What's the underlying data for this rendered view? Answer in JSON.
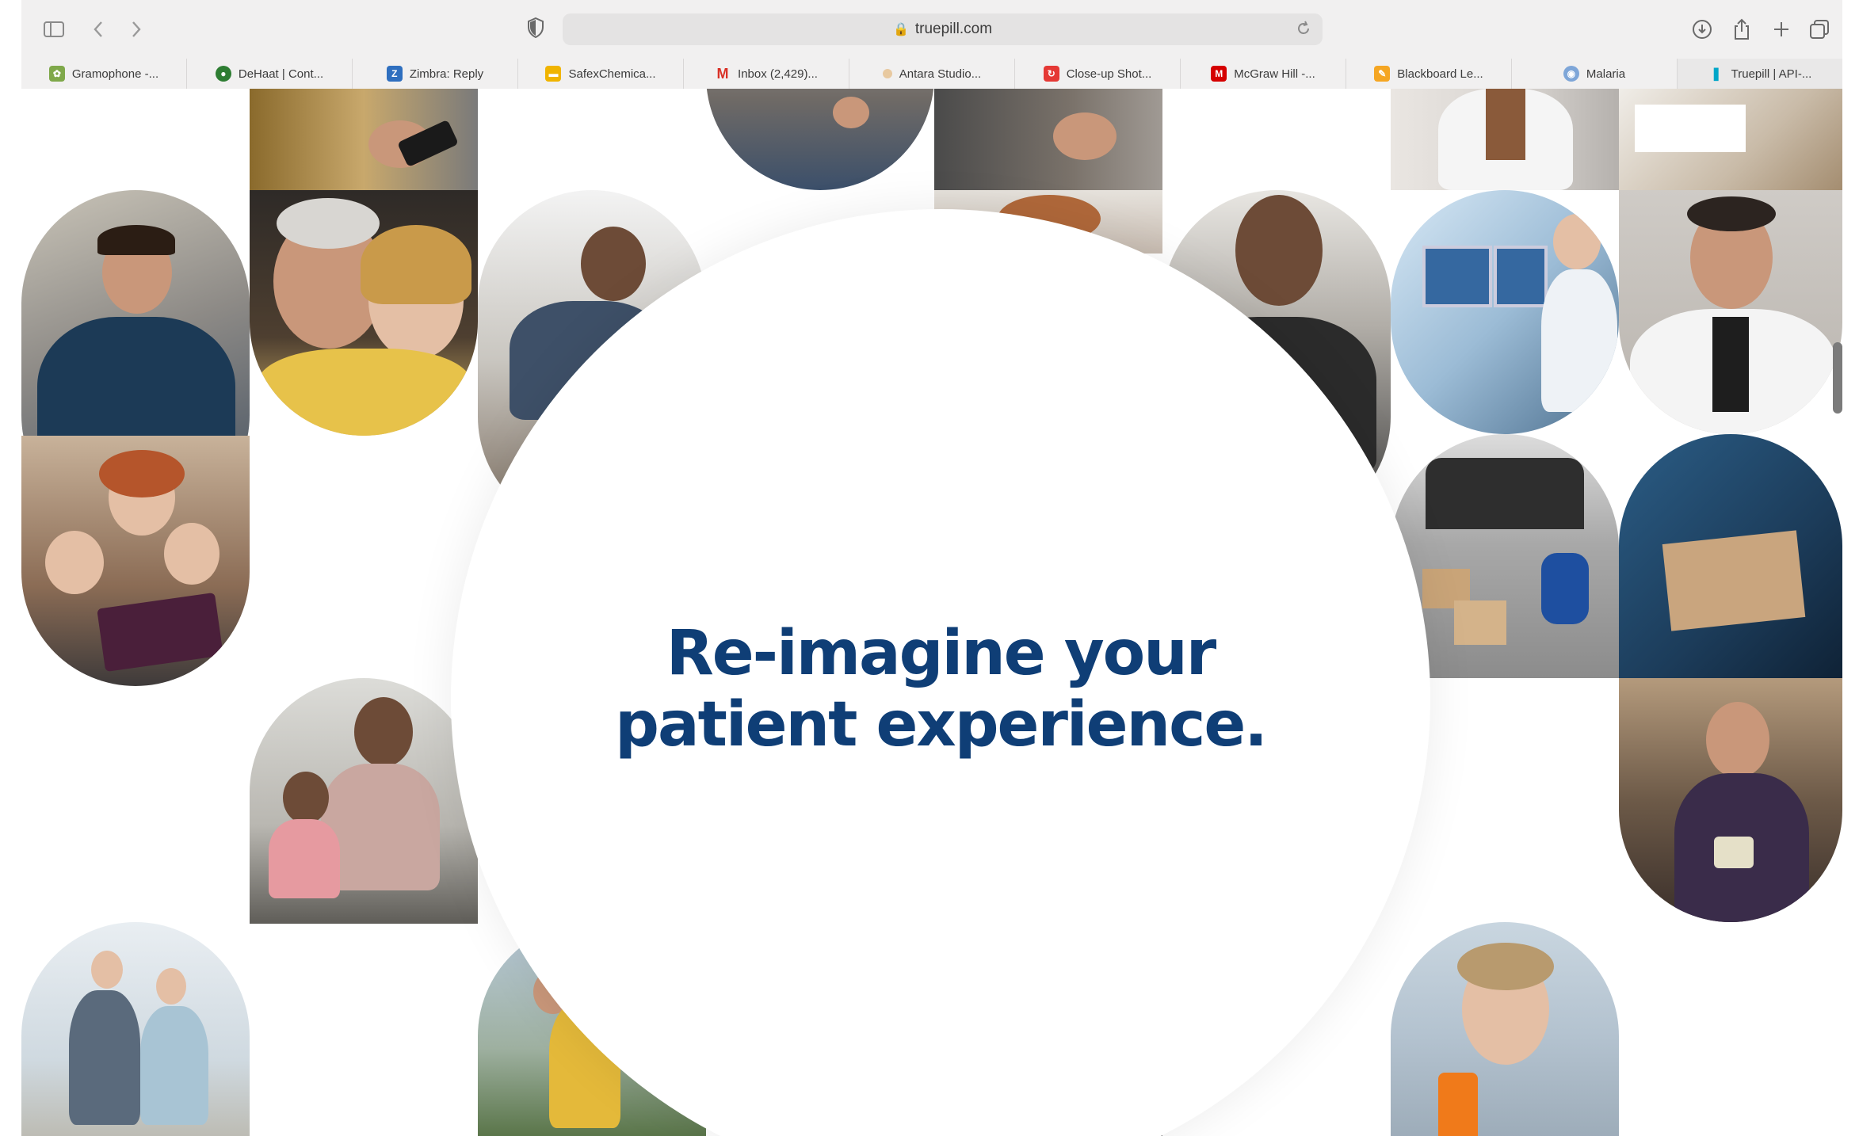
{
  "browser": {
    "url": "truepill.com",
    "bookmarks": [
      {
        "label": "Gramophone -...",
        "icon": "gramophone-favicon",
        "color": "#7fa84a"
      },
      {
        "label": "DeHaat | Cont...",
        "icon": "dehaat-favicon",
        "color": "#2e7d32"
      },
      {
        "label": "Zimbra: Reply",
        "icon": "zimbra-favicon",
        "color": "#2f6fbf"
      },
      {
        "label": "SafexChemica...",
        "icon": "safex-favicon",
        "color": "#f0b400"
      },
      {
        "label": "Inbox (2,429)...",
        "icon": "gmail-favicon",
        "color": "#d93025"
      },
      {
        "label": "Antara Studio...",
        "icon": "antara-favicon",
        "color": "#e8c9a0"
      },
      {
        "label": "Close-up Shot...",
        "icon": "closeup-favicon",
        "color": "#e53935"
      },
      {
        "label": "McGraw Hill -...",
        "icon": "mcgrawhill-favicon",
        "color": "#d50000"
      },
      {
        "label": "Blackboard Le...",
        "icon": "blackboard-favicon",
        "color": "#f5a623"
      },
      {
        "label": "Malaria",
        "icon": "malaria-favicon",
        "color": "#7ea6d8"
      },
      {
        "label": "Truepill | API-...",
        "icon": "truepill-favicon",
        "color": "#00a6c8"
      }
    ]
  },
  "hero": {
    "line1": "Re-imagine your",
    "line2": "patient experience.",
    "color": "#0f3e76"
  }
}
